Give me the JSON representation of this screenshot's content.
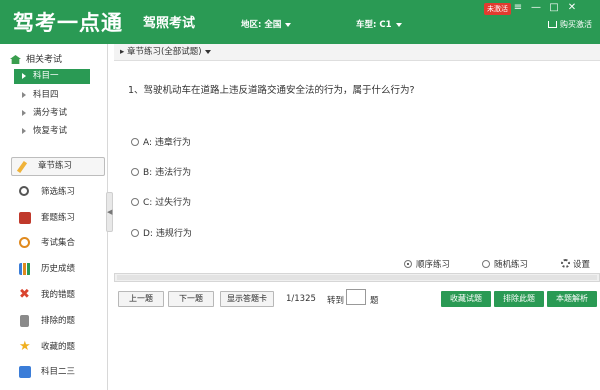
{
  "header": {
    "app_title": "驾考一点通",
    "subtitle": "驾照考试",
    "region_label": "地区: 全国",
    "car_label": "车型: C1",
    "badge": "未激活",
    "buy_label": "购买激活"
  },
  "sidebar": {
    "related_title": "相关考试",
    "subjects": [
      {
        "label": "科目一",
        "active": true
      },
      {
        "label": "科目四",
        "active": false
      },
      {
        "label": "满分考试",
        "active": false
      },
      {
        "label": "恢复考试",
        "active": false
      }
    ],
    "chapter_button": "章节练习",
    "nav": [
      {
        "label": "筛选练习",
        "icon": "search-icon",
        "color": "#555555"
      },
      {
        "label": "套题练习",
        "icon": "book-icon",
        "color": "#c0392b"
      },
      {
        "label": "考试集合",
        "icon": "clock-icon",
        "color": "#e08a1e"
      },
      {
        "label": "历史成绩",
        "icon": "bar-chart-icon",
        "color": "#3b7dd8"
      },
      {
        "label": "我的错题",
        "icon": "x-mark-icon",
        "color": "#d9442f"
      },
      {
        "label": "排除的题",
        "icon": "trash-icon",
        "color": "#7a7a7a"
      },
      {
        "label": "收藏的题",
        "icon": "star-icon",
        "color": "#f0b020"
      },
      {
        "label": "科目二三",
        "icon": "car-icon",
        "color": "#3b7dd8"
      }
    ]
  },
  "main": {
    "breadcrumb": "章节练习(全部试题)",
    "question": "1、驾驶机动车在道路上违反道路交通安全法的行为，属于什么行为?",
    "options": [
      "A: 违章行为",
      "B: 违法行为",
      "C: 过失行为",
      "D: 违规行为"
    ],
    "modes": [
      {
        "label": "顺序练习",
        "selected": true
      },
      {
        "label": "随机练习",
        "selected": false
      }
    ],
    "settings_label": "设置",
    "buttons": {
      "prev": "上一题",
      "next": "下一题",
      "answer_card": "显示答题卡"
    },
    "page_counter": "1/1325",
    "goto_label": "转到",
    "goto_suffix": "题",
    "actions": [
      "收藏试题",
      "排除此题",
      "本题解析"
    ]
  }
}
